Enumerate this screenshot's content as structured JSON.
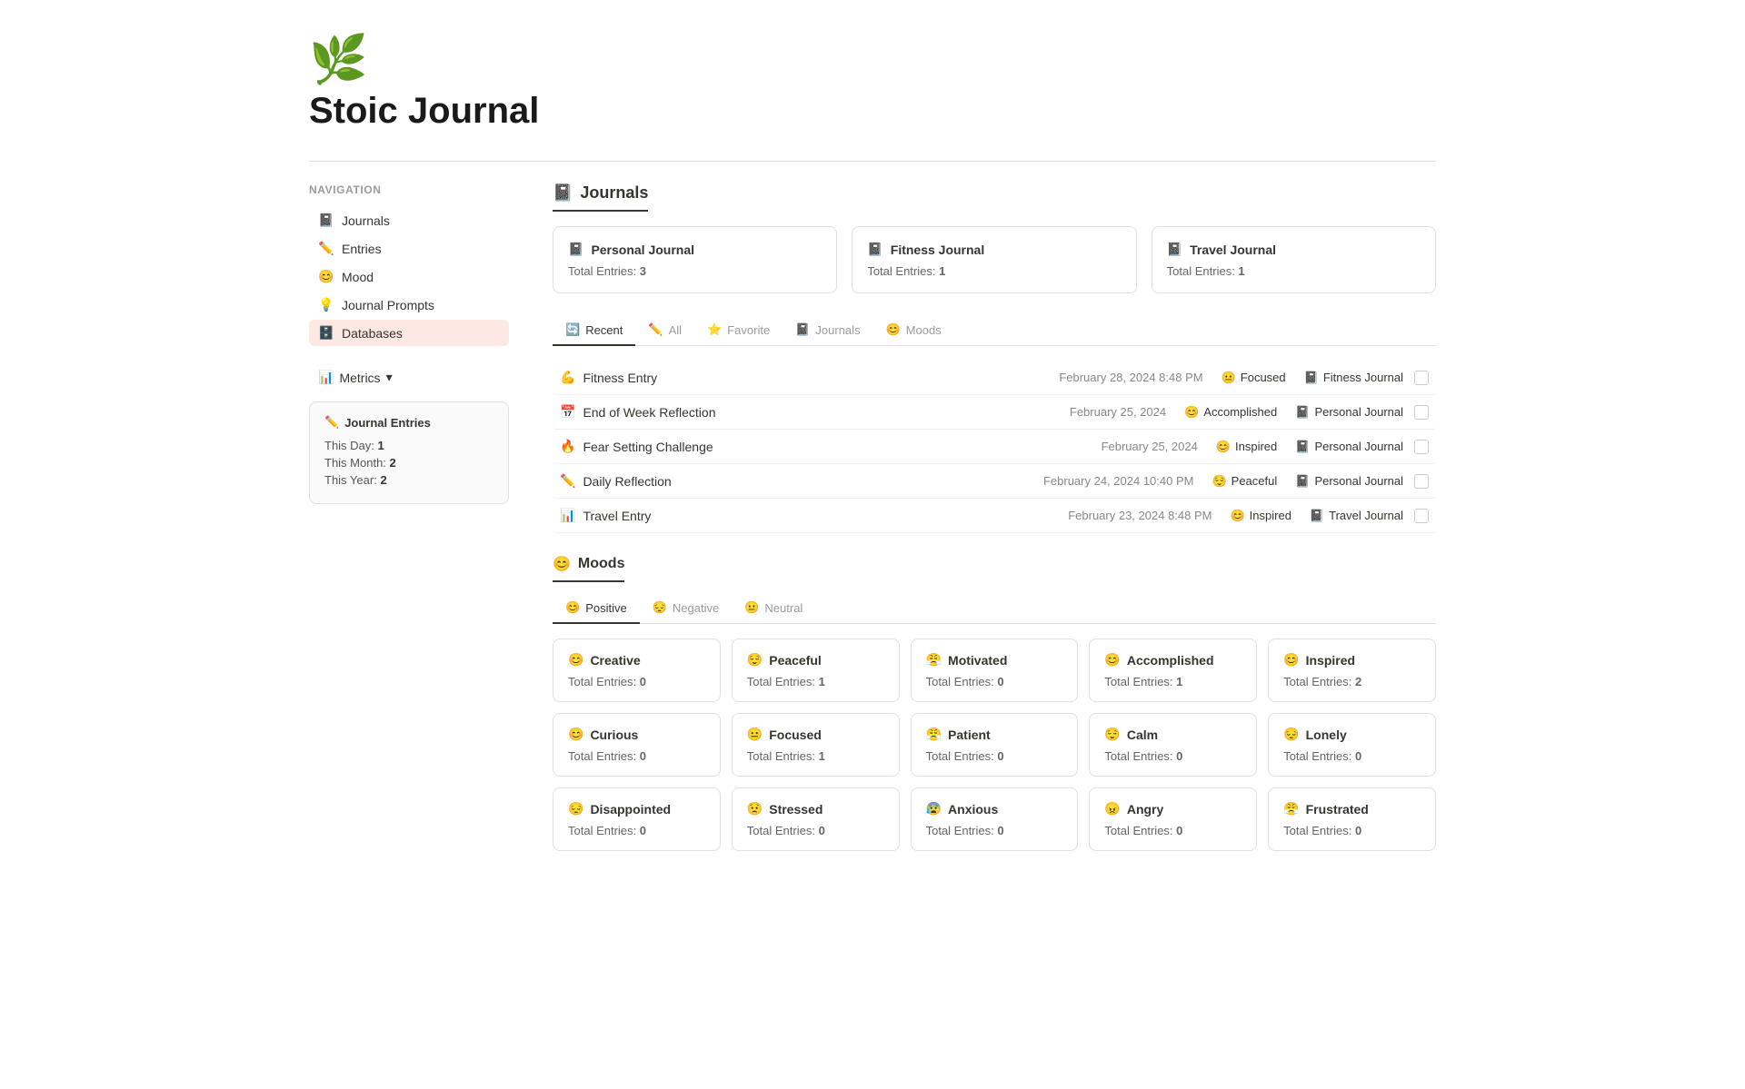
{
  "header": {
    "icon": "🌿",
    "title": "Stoic Journal"
  },
  "sidebar": {
    "nav_title": "Navigation",
    "nav_items": [
      {
        "id": "journals",
        "label": "Journals",
        "icon": "📓"
      },
      {
        "id": "entries",
        "label": "Entries",
        "icon": "✏️"
      },
      {
        "id": "mood",
        "label": "Mood",
        "icon": "😊"
      },
      {
        "id": "journal-prompts",
        "label": "Journal Prompts",
        "icon": "💡"
      },
      {
        "id": "databases",
        "label": "Databases",
        "icon": "🗄️",
        "active": true
      }
    ],
    "metrics_label": "Metrics",
    "metrics_card": {
      "title": "Journal Entries",
      "icon": "✏️",
      "rows": [
        {
          "label": "This Day:",
          "value": "1"
        },
        {
          "label": "This Month:",
          "value": "2"
        },
        {
          "label": "This Year:",
          "value": "2"
        }
      ]
    }
  },
  "main": {
    "journals_section": {
      "tab_label": "Journals",
      "tab_icon": "📓",
      "cards": [
        {
          "title": "Personal Journal",
          "icon": "📓",
          "meta": "Total Entries:",
          "count": "3"
        },
        {
          "title": "Fitness Journal",
          "icon": "📓",
          "meta": "Total Entries:",
          "count": "1"
        },
        {
          "title": "Travel Journal",
          "icon": "📓",
          "meta": "Total Entries:",
          "count": "1"
        }
      ]
    },
    "entries_section": {
      "tabs": [
        {
          "id": "recent",
          "label": "Recent",
          "icon": "🔄",
          "active": true
        },
        {
          "id": "all",
          "label": "All",
          "icon": "✏️"
        },
        {
          "id": "favorite",
          "label": "Favorite",
          "icon": "⭐"
        },
        {
          "id": "journals",
          "label": "Journals",
          "icon": "📓"
        },
        {
          "id": "moods",
          "label": "Moods",
          "icon": "😊"
        }
      ],
      "entries": [
        {
          "title": "Fitness Entry",
          "title_icon": "💪",
          "date": "February 28, 2024 8:48 PM",
          "mood": "Focused",
          "mood_icon": "😐",
          "journal": "Fitness Journal",
          "journal_icon": "📓"
        },
        {
          "title": "End of Week Reflection",
          "title_icon": "📅",
          "date": "February 25, 2024",
          "mood": "Accomplished",
          "mood_icon": "😊",
          "journal": "Personal Journal",
          "journal_icon": "📓"
        },
        {
          "title": "Fear Setting Challenge",
          "title_icon": "🔥",
          "date": "February 25, 2024",
          "mood": "Inspired",
          "mood_icon": "😊",
          "journal": "Personal Journal",
          "journal_icon": "📓"
        },
        {
          "title": "Daily Reflection",
          "title_icon": "✏️",
          "date": "February 24, 2024 10:40 PM",
          "mood": "Peaceful",
          "mood_icon": "😌",
          "journal": "Personal Journal",
          "journal_icon": "📓"
        },
        {
          "title": "Travel Entry",
          "title_icon": "📊",
          "date": "February 23, 2024 8:48 PM",
          "mood": "Inspired",
          "mood_icon": "😊",
          "journal": "Travel Journal",
          "journal_icon": "📓"
        }
      ]
    },
    "moods_section": {
      "header_label": "Moods",
      "header_icon": "😊",
      "tabs": [
        {
          "id": "positive",
          "label": "Positive",
          "icon": "😊",
          "active": true
        },
        {
          "id": "negative",
          "label": "Negative",
          "icon": "😔"
        },
        {
          "id": "neutral",
          "label": "Neutral",
          "icon": "😐"
        }
      ],
      "moods": [
        {
          "name": "Creative",
          "icon": "😊",
          "meta": "Total Entries:",
          "count": "0"
        },
        {
          "name": "Peaceful",
          "icon": "😌",
          "meta": "Total Entries:",
          "count": "1"
        },
        {
          "name": "Motivated",
          "icon": "😤",
          "meta": "Total Entries:",
          "count": "0"
        },
        {
          "name": "Accomplished",
          "icon": "😊",
          "meta": "Total Entries:",
          "count": "1"
        },
        {
          "name": "Inspired",
          "icon": "😊",
          "meta": "Total Entries:",
          "count": "2"
        },
        {
          "name": "Curious",
          "icon": "😊",
          "meta": "Total Entries:",
          "count": "0"
        },
        {
          "name": "Focused",
          "icon": "😐",
          "meta": "Total Entries:",
          "count": "1"
        },
        {
          "name": "Patient",
          "icon": "😤",
          "meta": "Total Entries:",
          "count": "0"
        },
        {
          "name": "Calm",
          "icon": "😌",
          "meta": "Total Entries:",
          "count": "0"
        },
        {
          "name": "Lonely",
          "icon": "😔",
          "meta": "Total Entries:",
          "count": "0"
        },
        {
          "name": "Disappointed",
          "icon": "😔",
          "meta": "Total Entries:",
          "count": "0"
        },
        {
          "name": "Stressed",
          "icon": "😟",
          "meta": "Total Entries:",
          "count": "0"
        },
        {
          "name": "Anxious",
          "icon": "😰",
          "meta": "Total Entries:",
          "count": "0"
        },
        {
          "name": "Angry",
          "icon": "😠",
          "meta": "Total Entries:",
          "count": "0"
        },
        {
          "name": "Frustrated",
          "icon": "😤",
          "meta": "Total Entries:",
          "count": "0"
        }
      ]
    }
  }
}
